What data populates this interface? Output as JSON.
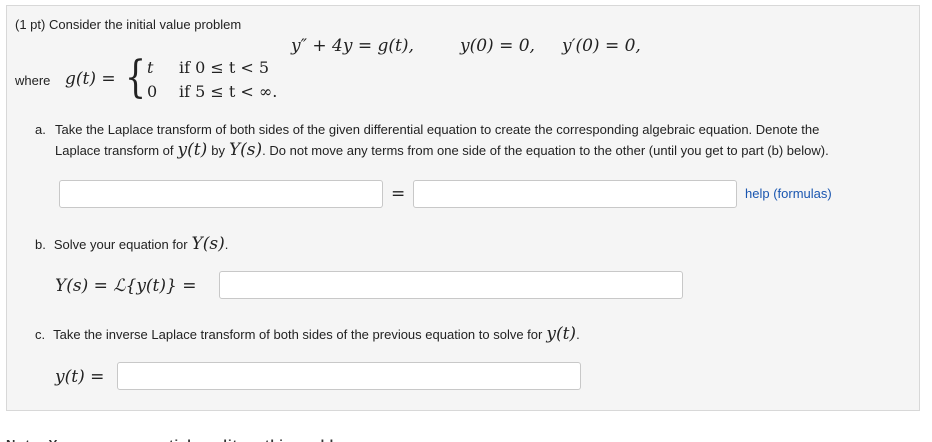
{
  "header": {
    "points": "(1 pt)",
    "intro": "Consider the initial value problem"
  },
  "ode": {
    "equation": "y″ + 4y = g(t),",
    "ic1": "y(0) = 0,",
    "ic2": "y′(0) = 0,"
  },
  "piecewise": {
    "where_label": "where",
    "lhs": "g(t) =",
    "row1_value": "t",
    "row1_condition": "if 0 ≤ t < 5",
    "row2_value": "0",
    "row2_condition": "if 5 ≤ t < ∞."
  },
  "part_a": {
    "marker": "a.",
    "text_line1": "Take the Laplace transform of both sides of the given differential equation to create the corresponding algebraic equation. Denote the",
    "text_line2_pre": "Laplace transform of",
    "math_y_t": "y(t)",
    "text_by": "by",
    "math_Y_s": "Y(s)",
    "text_line2_post": ". Do not move any terms from one side of the equation to the other (until you get to part (b) below).",
    "left_input_value": "",
    "equals": "=",
    "right_input_value": "",
    "help_link": "help (formulas)"
  },
  "part_b": {
    "marker": "b.",
    "text_pre": "Solve your equation for",
    "math_Y_s": "Y(s)",
    "text_post": ".",
    "answer_label": "Y(s) = ℒ{y(t)} =",
    "input_value": ""
  },
  "part_c": {
    "marker": "c.",
    "text_pre": "Take the inverse Laplace transform of both sides of the previous equation to solve for",
    "math_y_t": "y(t)",
    "text_post": ".",
    "answer_label": "y(t) =",
    "input_value": ""
  },
  "footer_cut": {
    "text": "Note: You can earn partial credit on this problem."
  }
}
